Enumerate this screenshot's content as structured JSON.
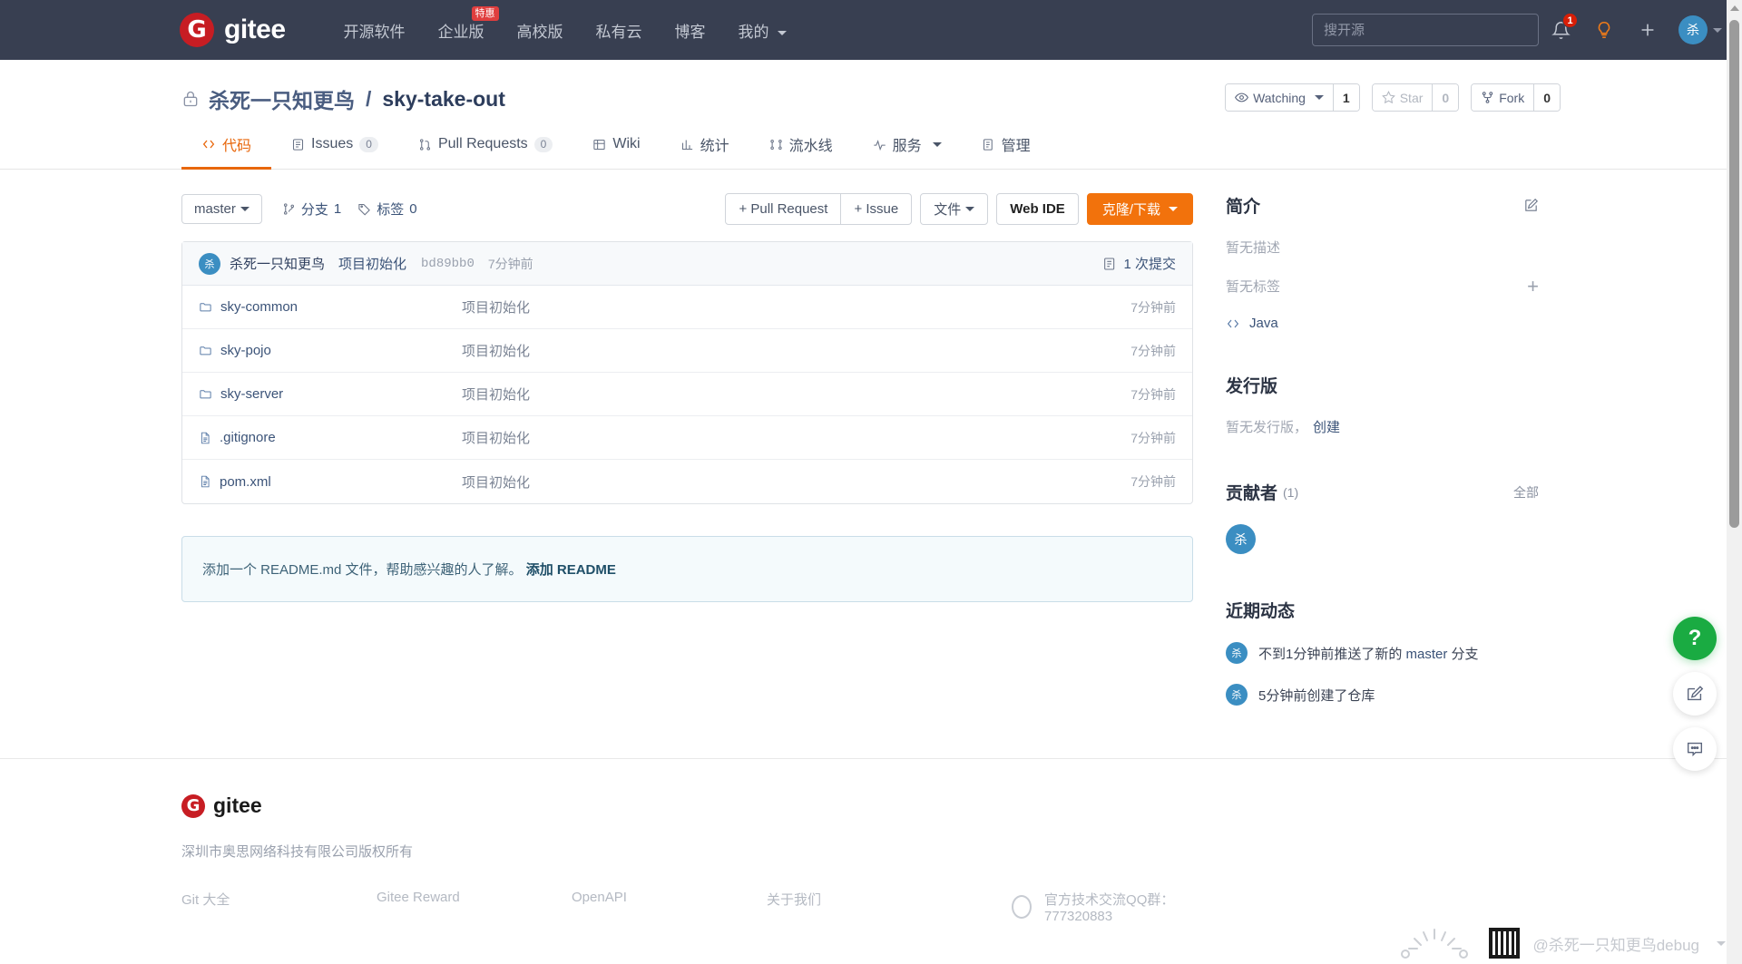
{
  "topnav": {
    "brand": "gitee",
    "brand_mark": "G",
    "links": [
      {
        "label": "开源软件",
        "badge": ""
      },
      {
        "label": "企业版",
        "badge": "特惠"
      },
      {
        "label": "高校版",
        "badge": ""
      },
      {
        "label": "私有云",
        "badge": ""
      },
      {
        "label": "博客",
        "badge": ""
      },
      {
        "label": "我的",
        "badge": "",
        "caret": true
      }
    ],
    "search_placeholder": "搜开源",
    "search_value": "",
    "notification_count": "1",
    "avatar_initial": "杀"
  },
  "repo": {
    "owner": "杀死一只知更鸟",
    "separator": "/",
    "name": "sky-take-out",
    "watch_label": "Watching",
    "watch_count": "1",
    "star_label": "Star",
    "star_count": "0",
    "fork_label": "Fork",
    "fork_count": "0"
  },
  "tabs": [
    {
      "label": "代码",
      "count": "",
      "active": true,
      "icon": "code-icon"
    },
    {
      "label": "Issues",
      "count": "0",
      "active": false,
      "icon": "issue-icon"
    },
    {
      "label": "Pull Requests",
      "count": "0",
      "active": false,
      "icon": "pull-request-icon"
    },
    {
      "label": "Wiki",
      "count": "",
      "active": false,
      "icon": "wiki-icon"
    },
    {
      "label": "统计",
      "count": "",
      "active": false,
      "icon": "stats-icon"
    },
    {
      "label": "流水线",
      "count": "",
      "active": false,
      "icon": "pipeline-icon"
    },
    {
      "label": "服务",
      "count": "",
      "active": false,
      "icon": "service-icon",
      "caret": true
    },
    {
      "label": "管理",
      "count": "",
      "active": false,
      "icon": "manage-icon"
    }
  ],
  "toolbar": {
    "branch": "master",
    "branches_label": "分支",
    "branches_count": "1",
    "tags_label": "标签",
    "tags_count": "0",
    "pull_request_btn": "+ Pull Request",
    "issue_btn": "+ Issue",
    "files_btn": "文件",
    "webide_btn": "Web IDE",
    "clone_btn": "克隆/下载"
  },
  "commit_bar": {
    "avatar_initial": "杀",
    "author": "杀死一只知更鸟",
    "message": "项目初始化",
    "sha": "bd89bb0",
    "time": "7分钟前",
    "commit_count_label": "1 次提交"
  },
  "files": [
    {
      "name": "sky-common",
      "type": "folder",
      "message": "项目初始化",
      "time": "7分钟前"
    },
    {
      "name": "sky-pojo",
      "type": "folder",
      "message": "项目初始化",
      "time": "7分钟前"
    },
    {
      "name": "sky-server",
      "type": "folder",
      "message": "项目初始化",
      "time": "7分钟前"
    },
    {
      "name": ".gitignore",
      "type": "file",
      "message": "项目初始化",
      "time": "7分钟前"
    },
    {
      "name": "pom.xml",
      "type": "file",
      "message": "项目初始化",
      "time": "7分钟前"
    }
  ],
  "readme_prompt": {
    "text": "添加一个 README.md 文件，帮助感兴趣的人了解。",
    "link": "添加 README"
  },
  "sidebar": {
    "intro_title": "简介",
    "no_description": "暂无描述",
    "no_tags": "暂无标签",
    "language": "Java",
    "release_title": "发行版",
    "no_release": "暂无发行版，",
    "create_release": "创建",
    "contributors_title": "贡献者",
    "contributors_count": "(1)",
    "contributors_all": "全部",
    "contributors": [
      {
        "initial": "杀"
      }
    ],
    "activity_title": "近期动态",
    "activities": [
      {
        "initial": "杀",
        "prefix": "不到1分钟前推送了新的 ",
        "link": "master",
        "suffix": " 分支"
      },
      {
        "initial": "杀",
        "prefix": "5分钟前创建了仓库",
        "link": "",
        "suffix": ""
      }
    ]
  },
  "footer": {
    "brand_mark": "G",
    "brand": "gitee",
    "copyright": "深圳市奥思网络科技有限公司版权所有",
    "links": [
      "Git 大全",
      "Gitee Reward",
      "OpenAPI",
      "关于我们"
    ],
    "qq_text": "官方技术交流QQ群：777320883"
  },
  "fabs": [
    {
      "name": "help-fab",
      "glyph": "?"
    },
    {
      "name": "feedback-fab",
      "glyph": "edit"
    },
    {
      "name": "chat-fab",
      "glyph": "chat"
    }
  ],
  "watermark": {
    "text": "@杀死一只知更鸟debug"
  },
  "colors": {
    "nav_bg": "#383f51",
    "brand_red": "#c71d23",
    "accent_orange": "#e8670c",
    "primary_orange": "#f2720c",
    "link_blue": "#3b5378",
    "avatar_blue": "#3b8ec2",
    "green": "#1aab42"
  }
}
